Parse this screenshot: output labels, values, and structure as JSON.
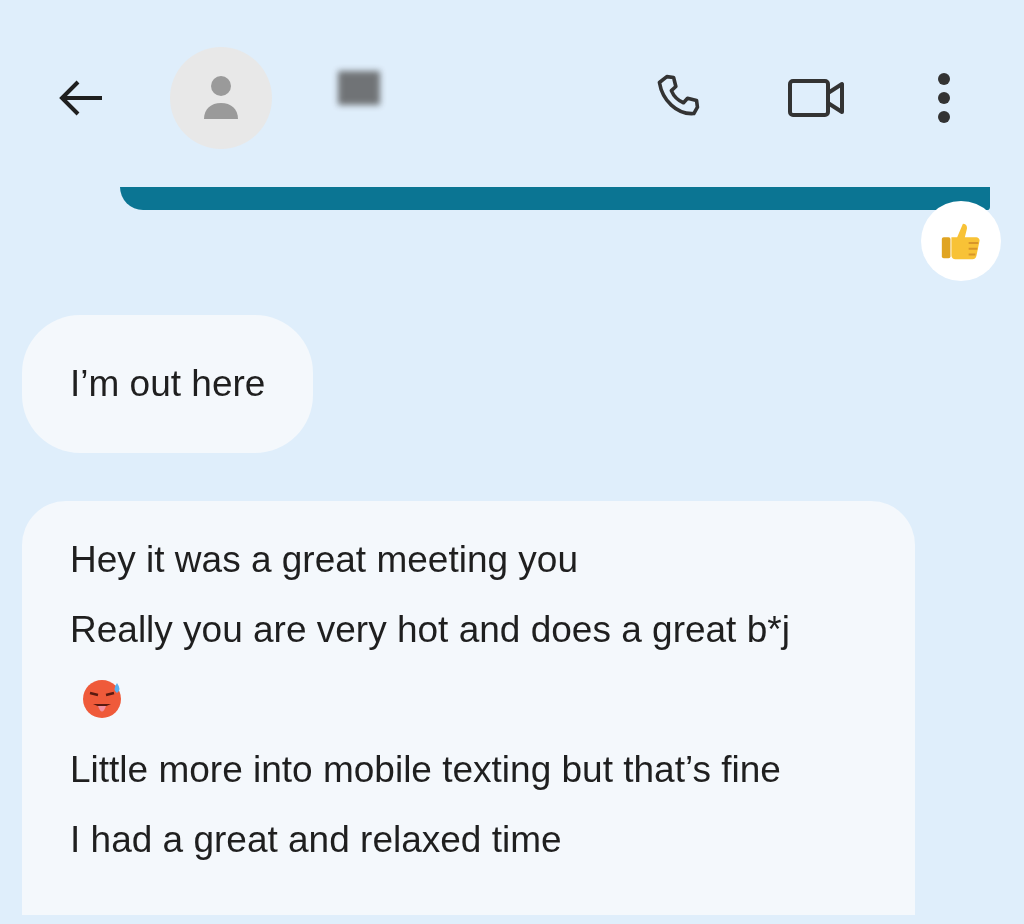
{
  "header": {
    "avatar": true,
    "name_blurred": true
  },
  "messages": [
    {
      "kind": "outgoing",
      "reacted": true
    },
    {
      "kind": "incoming",
      "lines": [
        {
          "text": "I’m out here"
        }
      ]
    },
    {
      "kind": "incoming",
      "lines": [
        {
          "text": "Hey it was a great meeting you"
        },
        {
          "text": "Really you are very hot and does a great b*j",
          "trailing_emoji": true
        },
        {
          "text": "Little more into mobile texting but that’s fine"
        },
        {
          "text": "I had a great and relaxed time"
        }
      ]
    }
  ]
}
